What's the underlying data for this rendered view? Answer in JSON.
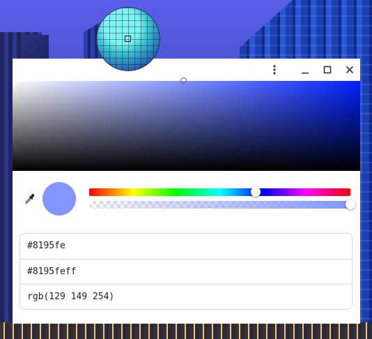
{
  "window": {
    "title_buttons": {
      "menu_icon": "more-vert-icon",
      "minimize_icon": "minimize-icon",
      "maximize_icon": "maximize-icon",
      "close_icon": "close-icon"
    }
  },
  "picker": {
    "selected_color": "#8195fe",
    "hue_fraction": 0.64,
    "alpha_fraction": 1.0,
    "saturation_fraction": 0.49,
    "value_fraction": 1.0
  },
  "formats": [
    {
      "value": "#8195fe"
    },
    {
      "value": "#8195feff"
    },
    {
      "value": "rgb(129 149 254)"
    }
  ],
  "icons": {
    "eyedropper": "eyedropper-icon",
    "loupe": "magnifier-loupe"
  }
}
